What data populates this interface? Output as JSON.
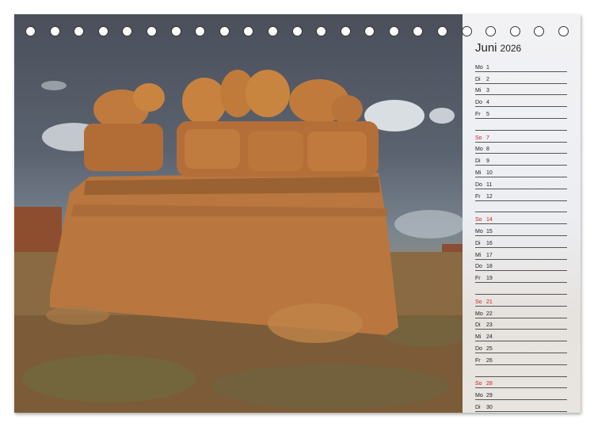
{
  "calendar": {
    "month": "Juni",
    "year": "2026",
    "rows": [
      {
        "wd": "Mo",
        "d": "1",
        "sunday": false
      },
      {
        "wd": "Di",
        "d": "2",
        "sunday": false
      },
      {
        "wd": "Mi",
        "d": "3",
        "sunday": false
      },
      {
        "wd": "Do",
        "d": "4",
        "sunday": false
      },
      {
        "wd": "Fr",
        "d": "5",
        "sunday": false
      },
      {
        "wd": "",
        "d": "",
        "sunday": false
      },
      {
        "wd": "So",
        "d": "7",
        "sunday": true
      },
      {
        "wd": "Mo",
        "d": "8",
        "sunday": false
      },
      {
        "wd": "Di",
        "d": "9",
        "sunday": false
      },
      {
        "wd": "Mi",
        "d": "10",
        "sunday": false
      },
      {
        "wd": "Do",
        "d": "11",
        "sunday": false
      },
      {
        "wd": "Fr",
        "d": "12",
        "sunday": false
      },
      {
        "wd": "",
        "d": "",
        "sunday": false
      },
      {
        "wd": "So",
        "d": "14",
        "sunday": true
      },
      {
        "wd": "Mo",
        "d": "15",
        "sunday": false
      },
      {
        "wd": "Di",
        "d": "16",
        "sunday": false
      },
      {
        "wd": "Mi",
        "d": "17",
        "sunday": false
      },
      {
        "wd": "Do",
        "d": "18",
        "sunday": false
      },
      {
        "wd": "Fr",
        "d": "19",
        "sunday": false
      },
      {
        "wd": "",
        "d": "",
        "sunday": false
      },
      {
        "wd": "So",
        "d": "21",
        "sunday": true
      },
      {
        "wd": "Mo",
        "d": "22",
        "sunday": false
      },
      {
        "wd": "Di",
        "d": "23",
        "sunday": false
      },
      {
        "wd": "Mi",
        "d": "24",
        "sunday": false
      },
      {
        "wd": "Do",
        "d": "25",
        "sunday": false
      },
      {
        "wd": "Fr",
        "d": "26",
        "sunday": false
      },
      {
        "wd": "",
        "d": "",
        "sunday": false
      },
      {
        "wd": "So",
        "d": "28",
        "sunday": true
      },
      {
        "wd": "Mo",
        "d": "29",
        "sunday": false
      },
      {
        "wd": "Di",
        "d": "30",
        "sunday": false
      }
    ]
  },
  "binding": {
    "hole_count": 23
  },
  "colors": {
    "sunday": "#cc2020",
    "rock": "#b5723a",
    "sky": "#4a4f5a"
  }
}
